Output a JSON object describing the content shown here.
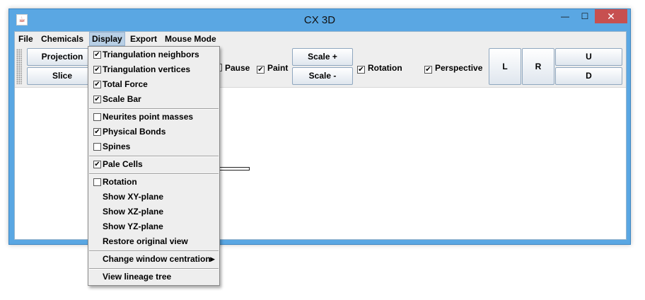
{
  "window": {
    "title": "CX 3D",
    "controls": {
      "minimize": "—",
      "maximize": "☐",
      "close": "✕"
    }
  },
  "menubar": {
    "items": [
      "File",
      "Chemicals",
      "Display",
      "Export",
      "Mouse Mode"
    ],
    "active": "Display"
  },
  "toolbar": {
    "projection": "Projection",
    "slice": "Slice",
    "pause": {
      "label": "Pause",
      "checked": false
    },
    "paint": {
      "label": "Paint",
      "checked": true
    },
    "scale_plus": "Scale +",
    "scale_minus": "Scale -",
    "rotation": {
      "label": "Rotation",
      "checked": true
    },
    "perspective": {
      "label": "Perspective",
      "checked": true
    },
    "left": "L",
    "right": "R",
    "up": "U",
    "down": "D"
  },
  "display_menu": {
    "items": [
      {
        "label": "Triangulation neighbors",
        "checkbox": true,
        "checked": true
      },
      {
        "label": "Triangulation vertices",
        "checkbox": true,
        "checked": true
      },
      {
        "label": "Total Force",
        "checkbox": true,
        "checked": true
      },
      {
        "label": "Scale Bar",
        "checkbox": true,
        "checked": true
      },
      {
        "label": "Neurites point masses",
        "checkbox": true,
        "checked": false
      },
      {
        "label": "Physical Bonds",
        "checkbox": true,
        "checked": true
      },
      {
        "label": "Spines",
        "checkbox": true,
        "checked": false
      },
      {
        "label": "Pale Cells",
        "checkbox": true,
        "checked": true
      },
      {
        "label": "Rotation",
        "checkbox": true,
        "checked": false
      },
      {
        "label": "Show XY-plane",
        "checkbox": false
      },
      {
        "label": "Show XZ-plane",
        "checkbox": false
      },
      {
        "label": "Show YZ-plane",
        "checkbox": false
      },
      {
        "label": "Restore original view",
        "checkbox": false
      },
      {
        "label": "Change window centration",
        "checkbox": false,
        "submenu": true
      },
      {
        "label": "View lineage tree",
        "checkbox": false
      }
    ]
  },
  "check_glyph": "✔"
}
